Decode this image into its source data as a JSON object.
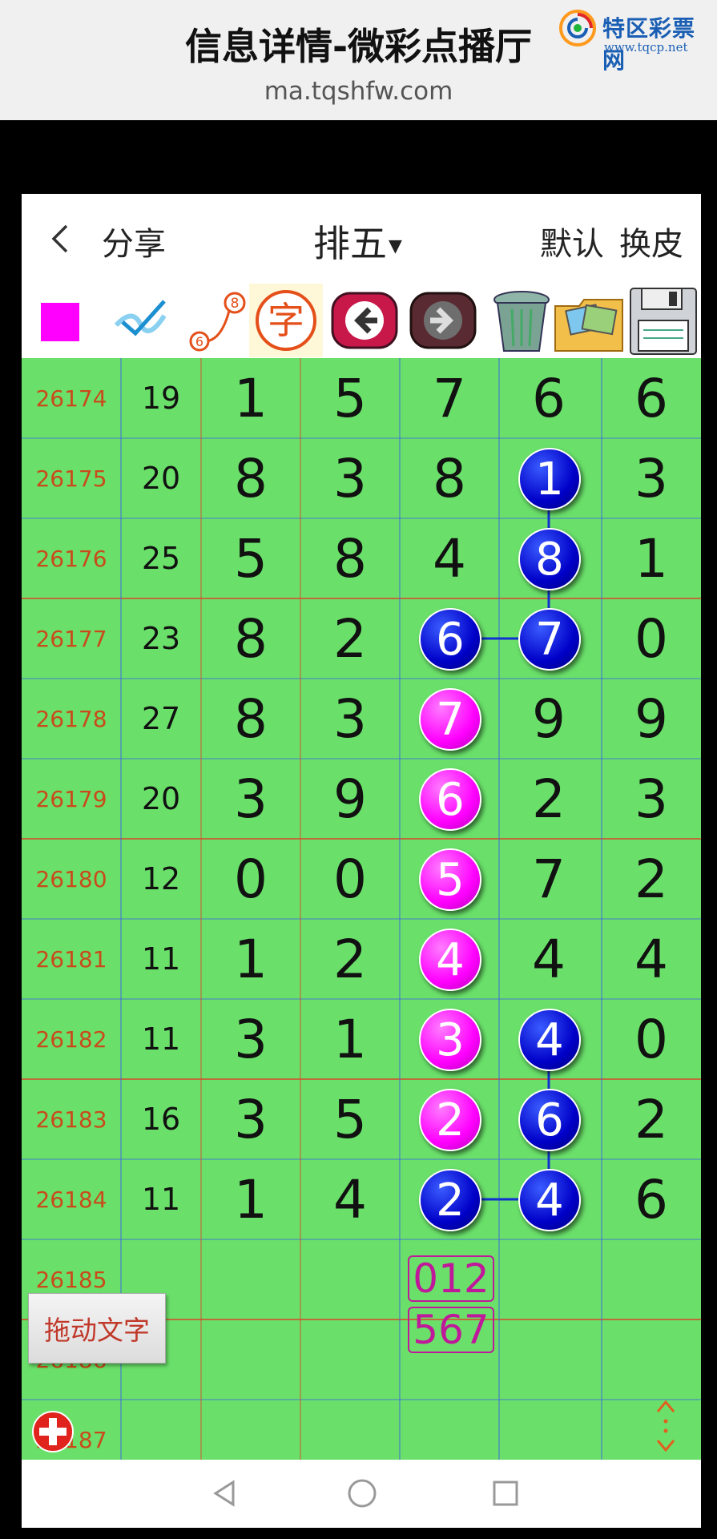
{
  "page": {
    "title": "信息详情-微彩点播厅",
    "url": "ma.tqshfw.com",
    "logo_brand": "特区彩票网",
    "logo_site": "www.tqcp.net"
  },
  "nav": {
    "share": "分享",
    "title": "排五",
    "default": "默认",
    "skin": "换皮"
  },
  "toolbar": {
    "items": [
      "color-square",
      "check-tool",
      "line-tool",
      "字",
      "back-arrow",
      "forward-arrow",
      "trash",
      "picture",
      "save"
    ],
    "zi_label": "字",
    "node_labels": [
      "8",
      "6"
    ],
    "colors": {
      "magenta": "#ff00ff",
      "grid_green": "#6ae06a",
      "ball_blue": "#0000c8",
      "period_text": "#c94a1a"
    }
  },
  "rows": [
    {
      "period": "26174",
      "sum": "19",
      "digits": [
        "1",
        "5",
        "7",
        "6",
        "6"
      ]
    },
    {
      "period": "26175",
      "sum": "20",
      "digits": [
        "8",
        "3",
        "8",
        "1",
        "3"
      ]
    },
    {
      "period": "26176",
      "sum": "25",
      "digits": [
        "5",
        "8",
        "4",
        "8",
        "1"
      ]
    },
    {
      "period": "26177",
      "sum": "23",
      "digits": [
        "8",
        "2",
        "6",
        "7",
        "0"
      ]
    },
    {
      "period": "26178",
      "sum": "27",
      "digits": [
        "8",
        "3",
        "7",
        "9",
        "9"
      ]
    },
    {
      "period": "26179",
      "sum": "20",
      "digits": [
        "3",
        "9",
        "6",
        "2",
        "3"
      ]
    },
    {
      "period": "26180",
      "sum": "12",
      "digits": [
        "0",
        "0",
        "5",
        "7",
        "2"
      ]
    },
    {
      "period": "26181",
      "sum": "11",
      "digits": [
        "1",
        "2",
        "4",
        "4",
        "4"
      ]
    },
    {
      "period": "26182",
      "sum": "11",
      "digits": [
        "3",
        "1",
        "3",
        "4",
        "0"
      ]
    },
    {
      "period": "26183",
      "sum": "16",
      "digits": [
        "3",
        "5",
        "2",
        "6",
        "2"
      ]
    },
    {
      "period": "26184",
      "sum": "11",
      "digits": [
        "1",
        "4",
        "2",
        "4",
        "6"
      ]
    },
    {
      "period": "26185",
      "sum": "",
      "digits": [
        "",
        "",
        "",
        "",
        ""
      ]
    },
    {
      "period": "26186",
      "sum": "",
      "digits": [
        "",
        "",
        "",
        "",
        ""
      ]
    },
    {
      "period": "26187",
      "sum": "",
      "digits": [
        "",
        "",
        "",
        "",
        ""
      ]
    }
  ],
  "highlights": [
    {
      "row": 1,
      "col": 3,
      "color": "blue"
    },
    {
      "row": 2,
      "col": 3,
      "color": "blue"
    },
    {
      "row": 3,
      "col": 2,
      "color": "blue"
    },
    {
      "row": 3,
      "col": 3,
      "color": "blue"
    },
    {
      "row": 4,
      "col": 2,
      "color": "magenta"
    },
    {
      "row": 5,
      "col": 2,
      "color": "magenta"
    },
    {
      "row": 6,
      "col": 2,
      "color": "magenta"
    },
    {
      "row": 7,
      "col": 2,
      "color": "magenta"
    },
    {
      "row": 8,
      "col": 2,
      "color": "magenta"
    },
    {
      "row": 8,
      "col": 3,
      "color": "blue"
    },
    {
      "row": 9,
      "col": 2,
      "color": "magenta"
    },
    {
      "row": 9,
      "col": 3,
      "color": "blue"
    },
    {
      "row": 10,
      "col": 2,
      "color": "blue"
    },
    {
      "row": 10,
      "col": 3,
      "color": "blue"
    }
  ],
  "connections": [
    {
      "from": [
        1,
        3
      ],
      "to": [
        2,
        3
      ]
    },
    {
      "from": [
        2,
        3
      ],
      "to": [
        3,
        3
      ]
    },
    {
      "from": [
        3,
        2
      ],
      "to": [
        3,
        3
      ]
    },
    {
      "from": [
        8,
        3
      ],
      "to": [
        9,
        3
      ]
    },
    {
      "from": [
        9,
        3
      ],
      "to": [
        10,
        3
      ]
    },
    {
      "from": [
        10,
        2
      ],
      "to": [
        10,
        3
      ]
    }
  ],
  "predictions": [
    "012",
    "567"
  ],
  "drag_text_label": "拖动文字"
}
